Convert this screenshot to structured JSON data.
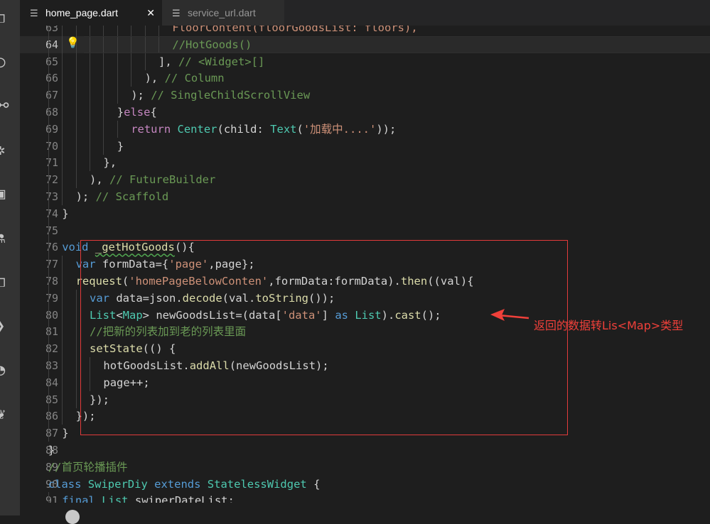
{
  "tabs": [
    {
      "label": "home_page.dart",
      "icon": "lines-file-icon",
      "close": "✕",
      "active": true
    },
    {
      "label": "service_url.dart",
      "icon": "lines-file-icon",
      "active": false
    }
  ],
  "activity_bar": [
    "explorer-icon",
    "search-icon",
    "source-control-icon",
    "debug-icon",
    "extensions-icon",
    "flask-icon",
    "remote-icon",
    "terminal-icon",
    "timeline-icon",
    "docker-icon"
  ],
  "annotation": {
    "text": "返回的数据转Lis<Map>类型",
    "color": "#f0403a"
  },
  "current_line": "64",
  "lines": [
    {
      "n": "63",
      "indent": 6,
      "seg": [
        {
          "t": "FloorContent(floorGoodsList: floors),",
          "c": "s"
        }
      ]
    },
    {
      "n": "64",
      "indent": 6,
      "seg": [
        {
          "t": "//HotGoods()",
          "c": "m"
        }
      ]
    },
    {
      "n": "65",
      "indent": 5,
      "seg": [
        {
          "t": "], ",
          "c": "d"
        },
        {
          "t": "// <Widget>[]",
          "c": "m"
        }
      ]
    },
    {
      "n": "66",
      "indent": 4,
      "seg": [
        {
          "t": "), ",
          "c": "d"
        },
        {
          "t": "// Column",
          "c": "m"
        }
      ]
    },
    {
      "n": "67",
      "indent": 3,
      "seg": [
        {
          "t": "); ",
          "c": "d"
        },
        {
          "t": "// SingleChildScrollView",
          "c": "m"
        }
      ]
    },
    {
      "n": "68",
      "indent": 2,
      "seg": [
        {
          "t": "}",
          "c": "d"
        },
        {
          "t": "else",
          "c": "c"
        },
        {
          "t": "{",
          "c": "d"
        }
      ]
    },
    {
      "n": "69",
      "indent": 3,
      "seg": [
        {
          "t": "return ",
          "c": "c"
        },
        {
          "t": "Center",
          "c": "t"
        },
        {
          "t": "(child: ",
          "c": "d"
        },
        {
          "t": "Text",
          "c": "t"
        },
        {
          "t": "(",
          "c": "d"
        },
        {
          "t": "'加载中....'",
          "c": "s"
        },
        {
          "t": "));",
          "c": "d"
        }
      ]
    },
    {
      "n": "70",
      "indent": 2,
      "seg": [
        {
          "t": "}",
          "c": "d"
        }
      ]
    },
    {
      "n": "71",
      "indent": 1,
      "seg": [
        {
          "t": "},",
          "c": "d"
        }
      ]
    },
    {
      "n": "72",
      "indent": 0,
      "seg": [
        {
          "t": "), ",
          "c": "d"
        },
        {
          "t": "// FutureBuilder",
          "c": "m"
        }
      ]
    },
    {
      "n": "73",
      "indent": -1,
      "seg": [
        {
          "t": "); ",
          "c": "d"
        },
        {
          "t": "// Scaffold",
          "c": "m"
        }
      ]
    },
    {
      "n": "74",
      "indent": -2,
      "seg": [
        {
          "t": "}",
          "c": "d"
        }
      ]
    },
    {
      "n": "75",
      "indent": -2,
      "seg": []
    },
    {
      "n": "76",
      "indent": -2,
      "seg": [
        {
          "t": "void ",
          "c": "k"
        },
        {
          "t": "_getHotGoods",
          "c": "f",
          "sq": true
        },
        {
          "t": "(){",
          "c": "d"
        }
      ]
    },
    {
      "n": "77",
      "indent": -1,
      "seg": [
        {
          "t": "var ",
          "c": "k"
        },
        {
          "t": "formData={",
          "c": "d"
        },
        {
          "t": "'page'",
          "c": "s"
        },
        {
          "t": ",page};",
          "c": "d"
        }
      ]
    },
    {
      "n": "78",
      "indent": -1,
      "seg": [
        {
          "t": "request",
          "c": "f"
        },
        {
          "t": "(",
          "c": "d"
        },
        {
          "t": "'homePageBelowConten'",
          "c": "s"
        },
        {
          "t": ",formData:formData).",
          "c": "d"
        },
        {
          "t": "then",
          "c": "f"
        },
        {
          "t": "((val){",
          "c": "d"
        }
      ]
    },
    {
      "n": "79",
      "indent": 0,
      "seg": [
        {
          "t": "var ",
          "c": "k"
        },
        {
          "t": "data=json.",
          "c": "d"
        },
        {
          "t": "decode",
          "c": "f"
        },
        {
          "t": "(val.",
          "c": "d"
        },
        {
          "t": "toString",
          "c": "f"
        },
        {
          "t": "());",
          "c": "d"
        }
      ]
    },
    {
      "n": "80",
      "indent": 0,
      "seg": [
        {
          "t": "List",
          "c": "t"
        },
        {
          "t": "<",
          "c": "d"
        },
        {
          "t": "Map",
          "c": "t"
        },
        {
          "t": "> newGoodsList=(data[",
          "c": "d"
        },
        {
          "t": "'data'",
          "c": "s"
        },
        {
          "t": "] ",
          "c": "d"
        },
        {
          "t": "as ",
          "c": "k"
        },
        {
          "t": "List",
          "c": "t"
        },
        {
          "t": ").",
          "c": "d"
        },
        {
          "t": "cast",
          "c": "f"
        },
        {
          "t": "();",
          "c": "d"
        }
      ]
    },
    {
      "n": "81",
      "indent": 0,
      "seg": [
        {
          "t": "//把新的列表加到老的列表里面",
          "c": "m"
        }
      ]
    },
    {
      "n": "82",
      "indent": 0,
      "seg": [
        {
          "t": "setState",
          "c": "f"
        },
        {
          "t": "(() {",
          "c": "d"
        }
      ]
    },
    {
      "n": "83",
      "indent": 1,
      "seg": [
        {
          "t": "hotGoodsList.",
          "c": "d"
        },
        {
          "t": "addAll",
          "c": "f"
        },
        {
          "t": "(newGoodsList);",
          "c": "d"
        }
      ]
    },
    {
      "n": "84",
      "indent": 1,
      "seg": [
        {
          "t": "page++;",
          "c": "d"
        }
      ]
    },
    {
      "n": "85",
      "indent": 0,
      "seg": [
        {
          "t": "});",
          "c": "d"
        }
      ]
    },
    {
      "n": "86",
      "indent": -1,
      "seg": [
        {
          "t": "});",
          "c": "d"
        }
      ]
    },
    {
      "n": "87",
      "indent": -2,
      "seg": [
        {
          "t": "}",
          "c": "d"
        }
      ]
    },
    {
      "n": "88",
      "indent": -3,
      "seg": [
        {
          "t": "}",
          "c": "d"
        }
      ]
    },
    {
      "n": "89",
      "indent": -3,
      "seg": [
        {
          "t": "//首页轮播插件",
          "c": "m"
        }
      ]
    },
    {
      "n": "90",
      "indent": -3,
      "seg": [
        {
          "t": "class ",
          "c": "k"
        },
        {
          "t": "SwiperDiy ",
          "c": "t"
        },
        {
          "t": "extends ",
          "c": "k"
        },
        {
          "t": "StatelessWidget ",
          "c": "t"
        },
        {
          "t": "{",
          "c": "d"
        }
      ]
    },
    {
      "n": "91",
      "indent": -2,
      "seg": [
        {
          "t": "final ",
          "c": "k"
        },
        {
          "t": "List ",
          "c": "t"
        },
        {
          "t": "swiperDateList;",
          "c": "d"
        }
      ]
    }
  ]
}
